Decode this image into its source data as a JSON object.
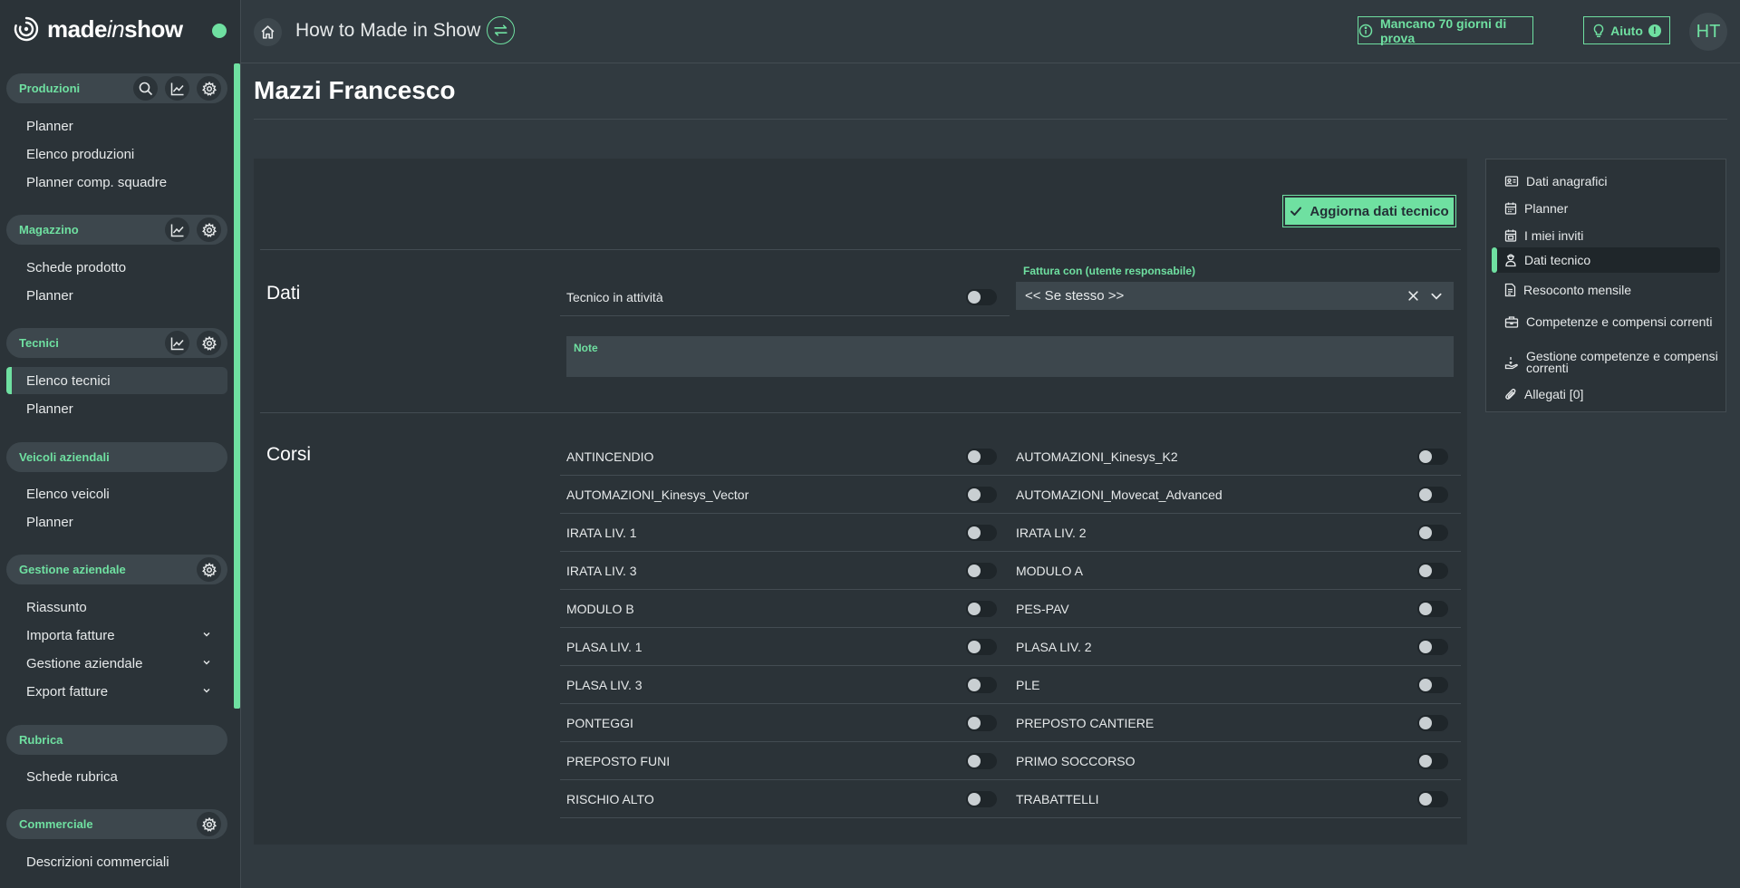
{
  "brand": {
    "name_prefix": "made",
    "name_italic": "in",
    "name_suffix": "show"
  },
  "header": {
    "app_title": "How to Made in Show",
    "trial_label": "Mancano 70 giorni di prova",
    "help_label": "Aiuto",
    "help_badge": "!",
    "avatar_initials": "HT"
  },
  "sidebar": {
    "sections": [
      {
        "title": "Produzioni",
        "items": [
          "Planner",
          "Elenco produzioni",
          "Planner comp. squadre"
        ]
      },
      {
        "title": "Magazzino",
        "items": [
          "Schede prodotto",
          "Planner"
        ]
      },
      {
        "title": "Tecnici",
        "items": [
          "Elenco tecnici",
          "Planner"
        ]
      },
      {
        "title": "Veicoli aziendali",
        "items": [
          "Elenco veicoli",
          "Planner"
        ]
      },
      {
        "title": "Gestione aziendale",
        "items": [
          "Riassunto",
          "Importa fatture",
          "Gestione aziendale",
          "Export fatture"
        ]
      },
      {
        "title": "Rubrica",
        "items": [
          "Schede rubrica"
        ]
      },
      {
        "title": "Commerciale",
        "items": [
          "Descrizioni commerciali"
        ]
      }
    ]
  },
  "page": {
    "title": "Mazzi Francesco",
    "save_label": "Aggiorna dati tecnico"
  },
  "dati": {
    "heading": "Dati",
    "active_label": "Tecnico in attività",
    "fattura_label": "Fattura con (utente responsabile)",
    "fattura_value": "<< Se stesso >>",
    "note_label": "Note"
  },
  "corsi": {
    "heading": "Corsi",
    "left": [
      "ANTINCENDIO",
      "AUTOMAZIONI_Kinesys_Vector",
      "IRATA LIV. 1",
      "IRATA LIV. 3",
      "MODULO B",
      "PLASA LIV. 1",
      "PLASA LIV. 3",
      "PONTEGGI",
      "PREPOSTO FUNI",
      "RISCHIO ALTO"
    ],
    "right": [
      "AUTOMAZIONI_Kinesys_K2",
      "AUTOMAZIONI_Movecat_Advanced",
      "IRATA LIV. 2",
      "MODULO A",
      "PES-PAV",
      "PLASA LIV. 2",
      "PLE",
      "PREPOSTO CANTIERE",
      "PRIMO SOCCORSO",
      "TRABATTELLI"
    ]
  },
  "side_nav": {
    "items": [
      "Dati anagrafici",
      "Planner",
      "I miei inviti",
      "Dati tecnico",
      "Resoconto mensile",
      "Competenze e compensi correnti",
      "Gestione competenze e compensi correnti",
      "Allegati [0]"
    ]
  },
  "colors": {
    "accent": "#6fe0a1",
    "background": "#313a40",
    "panel": "#2b3338",
    "field": "#3d474d"
  }
}
